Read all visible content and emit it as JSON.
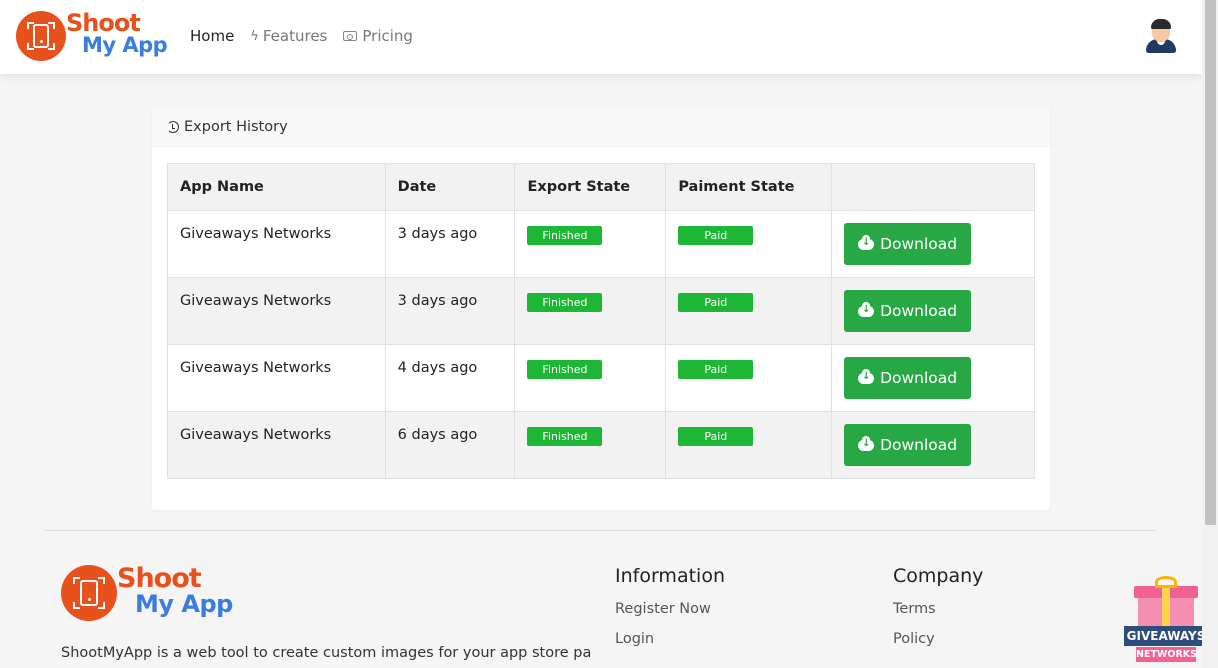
{
  "brand": {
    "line1": "Shoot",
    "line2": "My App"
  },
  "nav": {
    "items": [
      {
        "label": "Home",
        "icon": "none",
        "active": true
      },
      {
        "label": "Features",
        "icon": "bolt-icon"
      },
      {
        "label": "Pricing",
        "icon": "cash-icon"
      }
    ]
  },
  "card": {
    "title": "Export History",
    "columns": [
      "App Name",
      "Date",
      "Export State",
      "Paiment State",
      ""
    ],
    "rows": [
      {
        "app": "Giveaways Networks",
        "date": "3 days ago",
        "export_state": "Finished",
        "payment_state": "Paid",
        "action": "Download"
      },
      {
        "app": "Giveaways Networks",
        "date": "3 days ago",
        "export_state": "Finished",
        "payment_state": "Paid",
        "action": "Download"
      },
      {
        "app": "Giveaways Networks",
        "date": "4 days ago",
        "export_state": "Finished",
        "payment_state": "Paid",
        "action": "Download"
      },
      {
        "app": "Giveaways Networks",
        "date": "6 days ago",
        "export_state": "Finished",
        "payment_state": "Paid",
        "action": "Download"
      }
    ]
  },
  "footer": {
    "description": "ShootMyApp is a web tool to create custom images for your app store pages.",
    "information": {
      "title": "Information",
      "links": [
        "Register Now",
        "Login"
      ]
    },
    "company": {
      "title": "Company",
      "links": [
        "Terms",
        "Policy"
      ]
    }
  },
  "widget": {
    "line1": "GIVEAWAYS",
    "line2": "NETWORKS"
  },
  "colors": {
    "brand_orange": "#e8501c",
    "brand_blue": "#3b7ddd",
    "success": "#28a745",
    "badge_green": "#1db735"
  }
}
